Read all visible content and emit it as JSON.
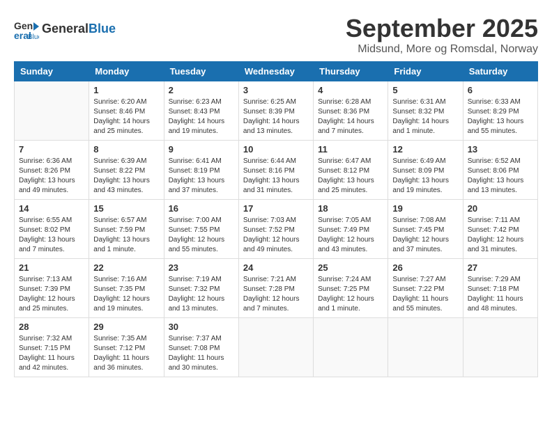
{
  "header": {
    "logo_line1": "General",
    "logo_line2": "Blue",
    "month": "September 2025",
    "location": "Midsund, More og Romsdal, Norway"
  },
  "weekdays": [
    "Sunday",
    "Monday",
    "Tuesday",
    "Wednesday",
    "Thursday",
    "Friday",
    "Saturday"
  ],
  "weeks": [
    [
      {
        "day": "",
        "info": ""
      },
      {
        "day": "1",
        "info": "Sunrise: 6:20 AM\nSunset: 8:46 PM\nDaylight: 14 hours\nand 25 minutes."
      },
      {
        "day": "2",
        "info": "Sunrise: 6:23 AM\nSunset: 8:43 PM\nDaylight: 14 hours\nand 19 minutes."
      },
      {
        "day": "3",
        "info": "Sunrise: 6:25 AM\nSunset: 8:39 PM\nDaylight: 14 hours\nand 13 minutes."
      },
      {
        "day": "4",
        "info": "Sunrise: 6:28 AM\nSunset: 8:36 PM\nDaylight: 14 hours\nand 7 minutes."
      },
      {
        "day": "5",
        "info": "Sunrise: 6:31 AM\nSunset: 8:32 PM\nDaylight: 14 hours\nand 1 minute."
      },
      {
        "day": "6",
        "info": "Sunrise: 6:33 AM\nSunset: 8:29 PM\nDaylight: 13 hours\nand 55 minutes."
      }
    ],
    [
      {
        "day": "7",
        "info": "Sunrise: 6:36 AM\nSunset: 8:26 PM\nDaylight: 13 hours\nand 49 minutes."
      },
      {
        "day": "8",
        "info": "Sunrise: 6:39 AM\nSunset: 8:22 PM\nDaylight: 13 hours\nand 43 minutes."
      },
      {
        "day": "9",
        "info": "Sunrise: 6:41 AM\nSunset: 8:19 PM\nDaylight: 13 hours\nand 37 minutes."
      },
      {
        "day": "10",
        "info": "Sunrise: 6:44 AM\nSunset: 8:16 PM\nDaylight: 13 hours\nand 31 minutes."
      },
      {
        "day": "11",
        "info": "Sunrise: 6:47 AM\nSunset: 8:12 PM\nDaylight: 13 hours\nand 25 minutes."
      },
      {
        "day": "12",
        "info": "Sunrise: 6:49 AM\nSunset: 8:09 PM\nDaylight: 13 hours\nand 19 minutes."
      },
      {
        "day": "13",
        "info": "Sunrise: 6:52 AM\nSunset: 8:06 PM\nDaylight: 13 hours\nand 13 minutes."
      }
    ],
    [
      {
        "day": "14",
        "info": "Sunrise: 6:55 AM\nSunset: 8:02 PM\nDaylight: 13 hours\nand 7 minutes."
      },
      {
        "day": "15",
        "info": "Sunrise: 6:57 AM\nSunset: 7:59 PM\nDaylight: 13 hours\nand 1 minute."
      },
      {
        "day": "16",
        "info": "Sunrise: 7:00 AM\nSunset: 7:55 PM\nDaylight: 12 hours\nand 55 minutes."
      },
      {
        "day": "17",
        "info": "Sunrise: 7:03 AM\nSunset: 7:52 PM\nDaylight: 12 hours\nand 49 minutes."
      },
      {
        "day": "18",
        "info": "Sunrise: 7:05 AM\nSunset: 7:49 PM\nDaylight: 12 hours\nand 43 minutes."
      },
      {
        "day": "19",
        "info": "Sunrise: 7:08 AM\nSunset: 7:45 PM\nDaylight: 12 hours\nand 37 minutes."
      },
      {
        "day": "20",
        "info": "Sunrise: 7:11 AM\nSunset: 7:42 PM\nDaylight: 12 hours\nand 31 minutes."
      }
    ],
    [
      {
        "day": "21",
        "info": "Sunrise: 7:13 AM\nSunset: 7:39 PM\nDaylight: 12 hours\nand 25 minutes."
      },
      {
        "day": "22",
        "info": "Sunrise: 7:16 AM\nSunset: 7:35 PM\nDaylight: 12 hours\nand 19 minutes."
      },
      {
        "day": "23",
        "info": "Sunrise: 7:19 AM\nSunset: 7:32 PM\nDaylight: 12 hours\nand 13 minutes."
      },
      {
        "day": "24",
        "info": "Sunrise: 7:21 AM\nSunset: 7:28 PM\nDaylight: 12 hours\nand 7 minutes."
      },
      {
        "day": "25",
        "info": "Sunrise: 7:24 AM\nSunset: 7:25 PM\nDaylight: 12 hours\nand 1 minute."
      },
      {
        "day": "26",
        "info": "Sunrise: 7:27 AM\nSunset: 7:22 PM\nDaylight: 11 hours\nand 55 minutes."
      },
      {
        "day": "27",
        "info": "Sunrise: 7:29 AM\nSunset: 7:18 PM\nDaylight: 11 hours\nand 48 minutes."
      }
    ],
    [
      {
        "day": "28",
        "info": "Sunrise: 7:32 AM\nSunset: 7:15 PM\nDaylight: 11 hours\nand 42 minutes."
      },
      {
        "day": "29",
        "info": "Sunrise: 7:35 AM\nSunset: 7:12 PM\nDaylight: 11 hours\nand 36 minutes."
      },
      {
        "day": "30",
        "info": "Sunrise: 7:37 AM\nSunset: 7:08 PM\nDaylight: 11 hours\nand 30 minutes."
      },
      {
        "day": "",
        "info": ""
      },
      {
        "day": "",
        "info": ""
      },
      {
        "day": "",
        "info": ""
      },
      {
        "day": "",
        "info": ""
      }
    ]
  ]
}
